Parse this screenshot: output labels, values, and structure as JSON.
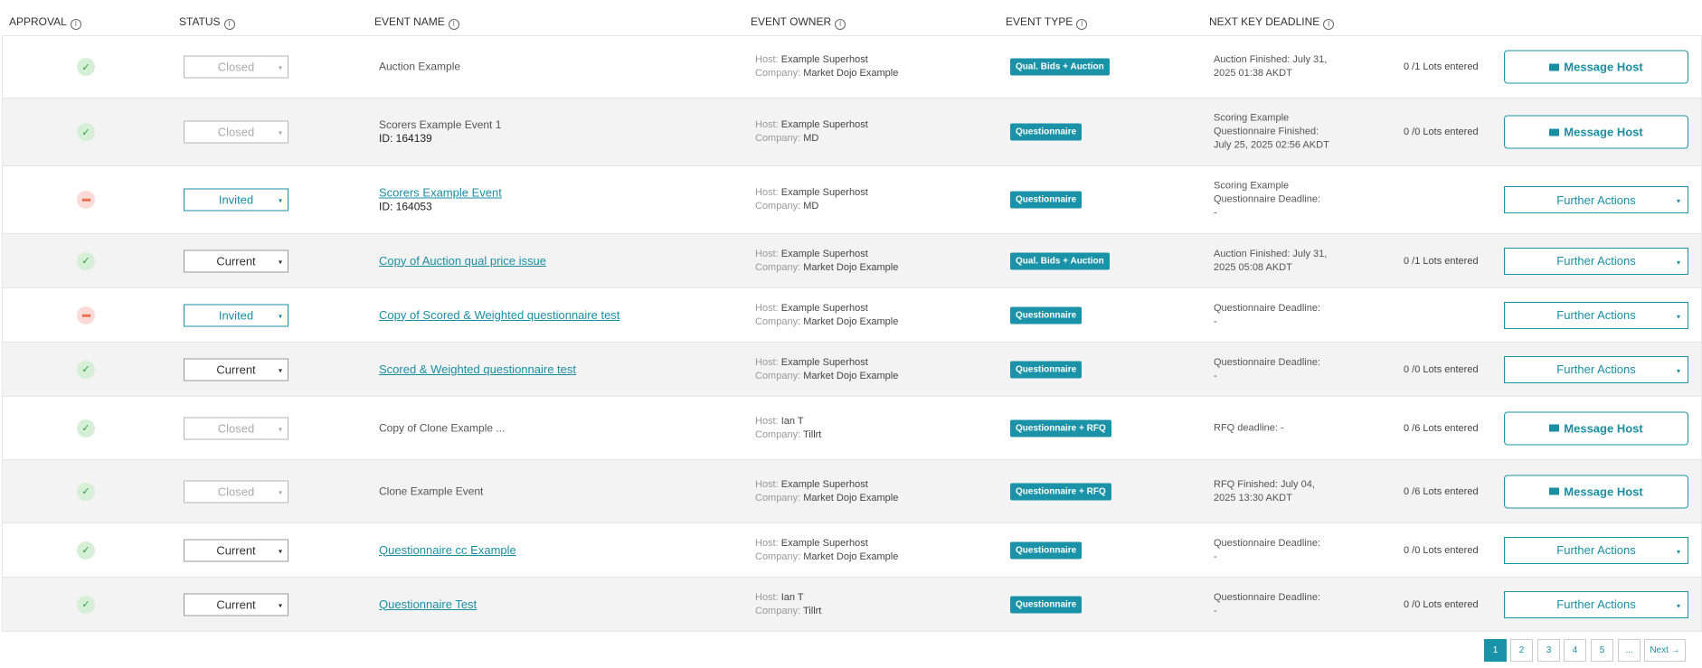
{
  "header": {
    "approval": "APPROVAL",
    "status": "STATUS",
    "event_name": "EVENT NAME",
    "event_owner": "EVENT OWNER",
    "event_type": "EVENT TYPE",
    "next_key_deadline": "NEXT KEY DEADLINE",
    "info_glyph": "i"
  },
  "labels": {
    "host": "Host:",
    "company": "Company:",
    "message_host": "Message Host",
    "further_actions": "Further Actions",
    "caret": "▾",
    "check": "✓",
    "dots": "•••"
  },
  "rows": [
    {
      "approval": "approved",
      "status": "Closed",
      "event_name": "Auction Example",
      "event_link": false,
      "event_id": "",
      "host": "Example Superhost",
      "company": "Market Dojo Example",
      "event_type": "Qual. Bids + Auction",
      "deadline_1": "Auction Finished: July 31,",
      "deadline_2": "2025 01:38 AKDT",
      "deadline_3": "",
      "lots": "0 /1 Lots entered",
      "action": "message"
    },
    {
      "approval": "approved",
      "status": "Closed",
      "event_name": "Scorers Example Event 1",
      "event_link": false,
      "event_id": "ID: 164139",
      "host": "Example Superhost",
      "company": "MD",
      "event_type": "Questionnaire",
      "deadline_1": "Scoring Example",
      "deadline_2": "Questionnaire Finished:",
      "deadline_3": "July 25, 2025 02:56 AKDT",
      "lots": "0 /0 Lots entered",
      "action": "message"
    },
    {
      "approval": "pending",
      "status": "Invited",
      "event_name": "Scorers Example Event",
      "event_link": true,
      "event_id": "ID: 164053",
      "host": "Example Superhost",
      "company": "MD",
      "event_type": "Questionnaire",
      "deadline_1": "Scoring Example",
      "deadline_2": "Questionnaire Deadline:",
      "deadline_3": "-",
      "lots": "",
      "action": "further"
    },
    {
      "approval": "approved",
      "status": "Current",
      "event_name": "Copy of Auction qual price issue",
      "event_link": true,
      "event_id": "",
      "host": "Example Superhost",
      "company": "Market Dojo Example",
      "event_type": "Qual. Bids + Auction",
      "deadline_1": "Auction Finished: July 31,",
      "deadline_2": "2025 05:08 AKDT",
      "deadline_3": "",
      "lots": "0 /1 Lots entered",
      "action": "further"
    },
    {
      "approval": "pending",
      "status": "Invited",
      "event_name": "Copy of Scored & Weighted questionnaire test",
      "event_link": true,
      "event_id": "",
      "host": "Example Superhost",
      "company": "Market Dojo Example",
      "event_type": "Questionnaire",
      "deadline_1": "Questionnaire Deadline:",
      "deadline_2": "-",
      "deadline_3": "",
      "lots": "",
      "action": "further"
    },
    {
      "approval": "approved",
      "status": "Current",
      "event_name": "Scored & Weighted questionnaire test",
      "event_link": true,
      "event_id": "",
      "host": "Example Superhost",
      "company": "Market Dojo Example",
      "event_type": "Questionnaire",
      "deadline_1": "Questionnaire Deadline:",
      "deadline_2": "-",
      "deadline_3": "",
      "lots": "0 /0 Lots entered",
      "action": "further"
    },
    {
      "approval": "approved",
      "status": "Closed",
      "event_name": "Copy of Clone Example ...",
      "event_link": false,
      "event_id": "",
      "host": "Ian T",
      "company": "Tillrt",
      "event_type": "Questionnaire + RFQ",
      "deadline_1": "RFQ deadline: -",
      "deadline_2": "",
      "deadline_3": "",
      "lots": "0 /6 Lots entered",
      "action": "message"
    },
    {
      "approval": "approved",
      "status": "Closed",
      "event_name": "Clone Example Event",
      "event_link": false,
      "event_id": "",
      "host": "Example Superhost",
      "company": "Market Dojo Example",
      "event_type": "Questionnaire + RFQ",
      "deadline_1": "RFQ Finished: July 04,",
      "deadline_2": "2025 13:30 AKDT",
      "deadline_3": "",
      "lots": "0 /6 Lots entered",
      "action": "message"
    },
    {
      "approval": "approved",
      "status": "Current",
      "event_name": "Questionnaire cc Example",
      "event_link": true,
      "event_id": "",
      "host": "Example Superhost",
      "company": "Market Dojo Example",
      "event_type": "Questionnaire",
      "deadline_1": "Questionnaire Deadline:",
      "deadline_2": "-",
      "deadline_3": "",
      "lots": "0 /0 Lots entered",
      "action": "further"
    },
    {
      "approval": "approved",
      "status": "Current",
      "event_name": "Questionnaire Test",
      "event_link": true,
      "event_id": "",
      "host": "Ian T",
      "company": "Tillrt",
      "event_type": "Questionnaire",
      "deadline_1": "Questionnaire Deadline:",
      "deadline_2": "-",
      "deadline_3": "",
      "lots": "0 /0 Lots entered",
      "action": "further"
    }
  ],
  "pagination": {
    "pages": [
      "1",
      "2",
      "3",
      "4",
      "5",
      "..."
    ],
    "active": "1",
    "next": "Next →"
  },
  "colors": {
    "accent": "#1a93a8",
    "approved": "#2e9c3e",
    "pending": "#e76f4a"
  }
}
